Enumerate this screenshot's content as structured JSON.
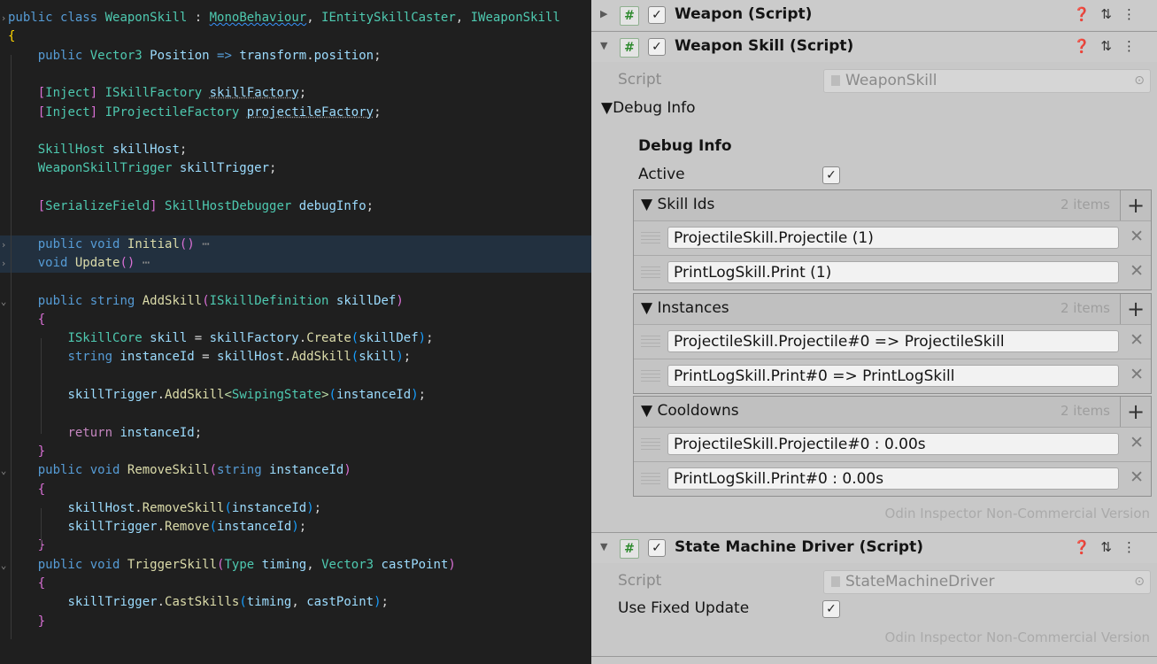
{
  "editor": {
    "lines": [
      {
        "fold": "›",
        "tokens": [
          [
            "kw",
            "public "
          ],
          [
            "kw",
            "class "
          ],
          [
            "ty",
            "WeaponSkill"
          ],
          [
            "pl",
            " : "
          ],
          [
            "ty squig",
            "MonoBehaviour"
          ],
          [
            "pl",
            ", "
          ],
          [
            "ty",
            "IEntitySkillCaster"
          ],
          [
            "pl",
            ", "
          ],
          [
            "ty",
            "IWeaponSkill"
          ]
        ]
      },
      {
        "tokens": [
          [
            "brY",
            "{"
          ]
        ]
      },
      {
        "tokens": [
          [
            "pl",
            "    "
          ],
          [
            "kw",
            "public "
          ],
          [
            "ty",
            "Vector3 "
          ],
          [
            "id",
            "Position "
          ],
          [
            "kw",
            "=> "
          ],
          [
            "id",
            "transform"
          ],
          [
            "pl",
            "."
          ],
          [
            "id",
            "position"
          ],
          [
            "pl",
            ";"
          ]
        ]
      },
      {
        "tokens": []
      },
      {
        "tokens": [
          [
            "pl",
            "    "
          ],
          [
            "brP",
            "["
          ],
          [
            "ty",
            "Inject"
          ],
          [
            "brP",
            "]"
          ],
          [
            "pl",
            " "
          ],
          [
            "ty",
            "ISkillFactory "
          ],
          [
            "id dots",
            "skillFactory"
          ],
          [
            "pl",
            ";"
          ]
        ]
      },
      {
        "tokens": [
          [
            "pl",
            "    "
          ],
          [
            "brP",
            "["
          ],
          [
            "ty",
            "Inject"
          ],
          [
            "brP",
            "]"
          ],
          [
            "pl",
            " "
          ],
          [
            "ty",
            "IProjectileFactory "
          ],
          [
            "id dots",
            "projectileFactory"
          ],
          [
            "pl",
            ";"
          ]
        ]
      },
      {
        "tokens": []
      },
      {
        "tokens": [
          [
            "pl",
            "    "
          ],
          [
            "ty",
            "SkillHost "
          ],
          [
            "id",
            "skillHost"
          ],
          [
            "pl",
            ";"
          ]
        ]
      },
      {
        "tokens": [
          [
            "pl",
            "    "
          ],
          [
            "ty",
            "WeaponSkillTrigger "
          ],
          [
            "id",
            "skillTrigger"
          ],
          [
            "pl",
            ";"
          ]
        ]
      },
      {
        "tokens": []
      },
      {
        "tokens": [
          [
            "pl",
            "    "
          ],
          [
            "brP",
            "["
          ],
          [
            "ty",
            "SerializeField"
          ],
          [
            "brP",
            "]"
          ],
          [
            "pl",
            " "
          ],
          [
            "ty",
            "SkillHostDebugger "
          ],
          [
            "id",
            "debugInfo"
          ],
          [
            "pl",
            ";"
          ]
        ]
      },
      {
        "tokens": []
      },
      {
        "fold": "›",
        "hl": true,
        "tokens": [
          [
            "pl",
            "    "
          ],
          [
            "kw",
            "public "
          ],
          [
            "kw",
            "void "
          ],
          [
            "fn",
            "Initial"
          ],
          [
            "brP",
            "()"
          ],
          [
            "ell",
            " ⋯"
          ]
        ]
      },
      {
        "fold": "›",
        "hl": true,
        "tokens": [
          [
            "pl",
            "    "
          ],
          [
            "kw",
            "void "
          ],
          [
            "fn",
            "Update"
          ],
          [
            "brP",
            "()"
          ],
          [
            "ell",
            " ⋯"
          ]
        ]
      },
      {
        "tokens": []
      },
      {
        "fold": "⌄",
        "tokens": [
          [
            "pl",
            "    "
          ],
          [
            "kw",
            "public "
          ],
          [
            "kw",
            "string "
          ],
          [
            "fn",
            "AddSkill"
          ],
          [
            "brP",
            "("
          ],
          [
            "ty",
            "ISkillDefinition "
          ],
          [
            "id",
            "skillDef"
          ],
          [
            "brP",
            ")"
          ]
        ]
      },
      {
        "tokens": [
          [
            "pl",
            "    "
          ],
          [
            "brP",
            "{"
          ]
        ]
      },
      {
        "tokens": [
          [
            "pl",
            "        "
          ],
          [
            "ty",
            "ISkillCore "
          ],
          [
            "id",
            "skill "
          ],
          [
            "pl",
            "= "
          ],
          [
            "id",
            "skillFactory"
          ],
          [
            "pl",
            "."
          ],
          [
            "fn",
            "Create"
          ],
          [
            "brB",
            "("
          ],
          [
            "id",
            "skillDef"
          ],
          [
            "brB",
            ")"
          ],
          [
            "pl",
            ";"
          ]
        ]
      },
      {
        "tokens": [
          [
            "pl",
            "        "
          ],
          [
            "kw",
            "string "
          ],
          [
            "id",
            "instanceId "
          ],
          [
            "pl",
            "= "
          ],
          [
            "id",
            "skillHost"
          ],
          [
            "pl",
            "."
          ],
          [
            "fn",
            "AddSkill"
          ],
          [
            "brB",
            "("
          ],
          [
            "id",
            "skill"
          ],
          [
            "brB",
            ")"
          ],
          [
            "pl",
            ";"
          ]
        ]
      },
      {
        "tokens": []
      },
      {
        "tokens": [
          [
            "pl",
            "        "
          ],
          [
            "id",
            "skillTrigger"
          ],
          [
            "pl",
            "."
          ],
          [
            "fn",
            "AddSkill"
          ],
          [
            "tp",
            "<"
          ],
          [
            "ty",
            "SwipingState"
          ],
          [
            "tp",
            ">"
          ],
          [
            "brB",
            "("
          ],
          [
            "id",
            "instanceId"
          ],
          [
            "brB",
            ")"
          ],
          [
            "pl",
            ";"
          ]
        ]
      },
      {
        "tokens": []
      },
      {
        "tokens": [
          [
            "pl",
            "        "
          ],
          [
            "ctl",
            "return "
          ],
          [
            "id",
            "instanceId"
          ],
          [
            "pl",
            ";"
          ]
        ]
      },
      {
        "tokens": [
          [
            "pl",
            "    "
          ],
          [
            "brP",
            "}"
          ]
        ]
      },
      {
        "fold": "⌄",
        "tokens": [
          [
            "pl",
            "    "
          ],
          [
            "kw",
            "public "
          ],
          [
            "kw",
            "void "
          ],
          [
            "fn",
            "RemoveSkill"
          ],
          [
            "brP",
            "("
          ],
          [
            "kw",
            "string "
          ],
          [
            "id",
            "instanceId"
          ],
          [
            "brP",
            ")"
          ]
        ]
      },
      {
        "tokens": [
          [
            "pl",
            "    "
          ],
          [
            "brP",
            "{"
          ]
        ]
      },
      {
        "tokens": [
          [
            "pl",
            "        "
          ],
          [
            "id",
            "skillHost"
          ],
          [
            "pl",
            "."
          ],
          [
            "fn",
            "RemoveSkill"
          ],
          [
            "brB",
            "("
          ],
          [
            "id",
            "instanceId"
          ],
          [
            "brB",
            ")"
          ],
          [
            "pl",
            ";"
          ]
        ]
      },
      {
        "tokens": [
          [
            "pl",
            "        "
          ],
          [
            "id",
            "skillTrigger"
          ],
          [
            "pl",
            "."
          ],
          [
            "fn",
            "Remove"
          ],
          [
            "brB",
            "("
          ],
          [
            "id",
            "instanceId"
          ],
          [
            "brB",
            ")"
          ],
          [
            "pl",
            ";"
          ]
        ]
      },
      {
        "tokens": [
          [
            "pl",
            "    "
          ],
          [
            "brP",
            "}"
          ]
        ]
      },
      {
        "fold": "⌄",
        "tokens": [
          [
            "pl",
            "    "
          ],
          [
            "kw",
            "public "
          ],
          [
            "kw",
            "void "
          ],
          [
            "fn",
            "TriggerSkill"
          ],
          [
            "brP",
            "("
          ],
          [
            "ty",
            "Type "
          ],
          [
            "id",
            "timing"
          ],
          [
            "pl",
            ", "
          ],
          [
            "ty",
            "Vector3 "
          ],
          [
            "id",
            "castPoint"
          ],
          [
            "brP",
            ")"
          ]
        ]
      },
      {
        "tokens": [
          [
            "pl",
            "    "
          ],
          [
            "brP",
            "{"
          ]
        ]
      },
      {
        "tokens": [
          [
            "pl",
            "        "
          ],
          [
            "id",
            "skillTrigger"
          ],
          [
            "pl",
            "."
          ],
          [
            "fn",
            "CastSkills"
          ],
          [
            "brB",
            "("
          ],
          [
            "id",
            "timing"
          ],
          [
            "pl",
            ", "
          ],
          [
            "id",
            "castPoint"
          ],
          [
            "brB",
            ")"
          ],
          [
            "pl",
            ";"
          ]
        ]
      },
      {
        "tokens": [
          [
            "pl",
            "    "
          ],
          [
            "brP",
            "}"
          ]
        ]
      }
    ]
  },
  "inspector": {
    "weapon": {
      "title": "Weapon (Script)",
      "arrow": "▶",
      "help_icon": "help-icon",
      "settings_icon": "preset-icon",
      "menu_icon": "kebab-icon"
    },
    "weapon_skill": {
      "title": "Weapon Skill (Script)",
      "arrow": "▼",
      "script_label": "Script",
      "script_value": "WeaponSkill",
      "debug_foldout": "Debug Info",
      "debug_title": "Debug Info",
      "active_label": "Active",
      "active_checked": true,
      "lists": [
        {
          "name": "Skill Ids",
          "count": "2 items",
          "items": [
            "ProjectileSkill.Projectile (1)",
            "PrintLogSkill.Print (1)"
          ]
        },
        {
          "name": "Instances",
          "count": "2 items",
          "items": [
            "ProjectileSkill.Projectile#0 => ProjectileSkill",
            "PrintLogSkill.Print#0 => PrintLogSkill"
          ]
        },
        {
          "name": "Cooldowns",
          "count": "2 items",
          "items": [
            "ProjectileSkill.Projectile#0 : 0.00s",
            "PrintLogSkill.Print#0 : 0.00s"
          ]
        }
      ],
      "odin_notice": "Odin Inspector Non-Commercial Version"
    },
    "state_machine": {
      "title": "State Machine Driver (Script)",
      "arrow": "▼",
      "script_label": "Script",
      "script_value": "StateMachineDriver",
      "fixed_label": "Use Fixed Update",
      "fixed_checked": true,
      "odin_notice": "Odin Inspector Non-Commercial Version"
    },
    "glyphs": {
      "hash": "#",
      "check": "✓",
      "help": "❓",
      "sliders": "⇅",
      "kebab": "⋮",
      "plus": "+",
      "close": "✕",
      "target": "⊙"
    }
  }
}
